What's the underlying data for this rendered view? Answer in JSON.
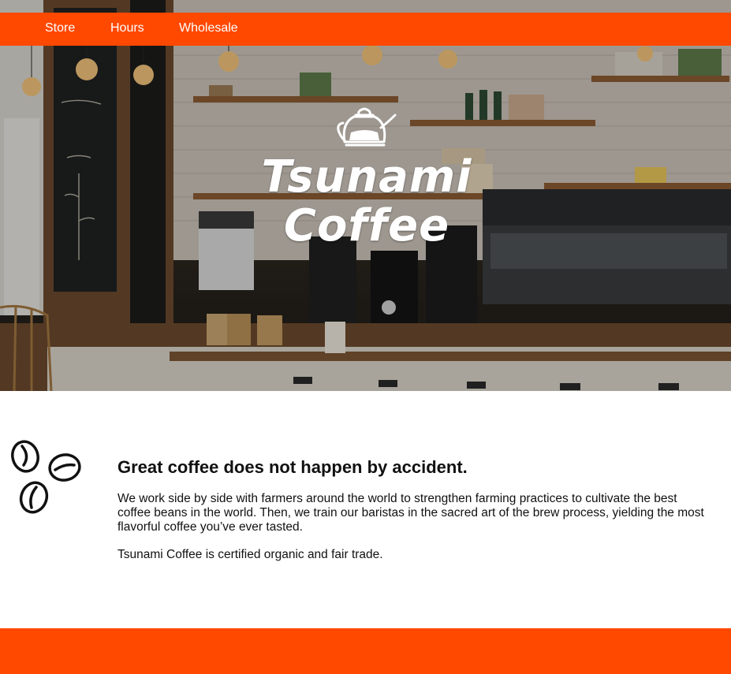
{
  "colors": {
    "brand_orange": "#ff4800",
    "text": "#111111",
    "background": "#ffffff"
  },
  "nav": {
    "items": [
      {
        "label": "Store"
      },
      {
        "label": "Hours"
      },
      {
        "label": "Wholesale"
      }
    ]
  },
  "hero": {
    "logo_icon": "kettle-icon",
    "logo_line1": "Tsunami",
    "logo_line2": "Coffee",
    "background_image": "coffee-shop-counter-photo"
  },
  "about": {
    "icon": "coffee-beans-icon",
    "heading": "Great coffee does not happen by accident.",
    "paragraph1": "We work side by side with farmers around the world to strengthen farming practices to cultivate the best coffee beans in the world. Then, we train our baristas in the sacred art of the brew process, yielding the most flavorful coffee you’ve ever tasted.",
    "paragraph2": "Tsunami Coffee is certified organic and fair trade."
  }
}
